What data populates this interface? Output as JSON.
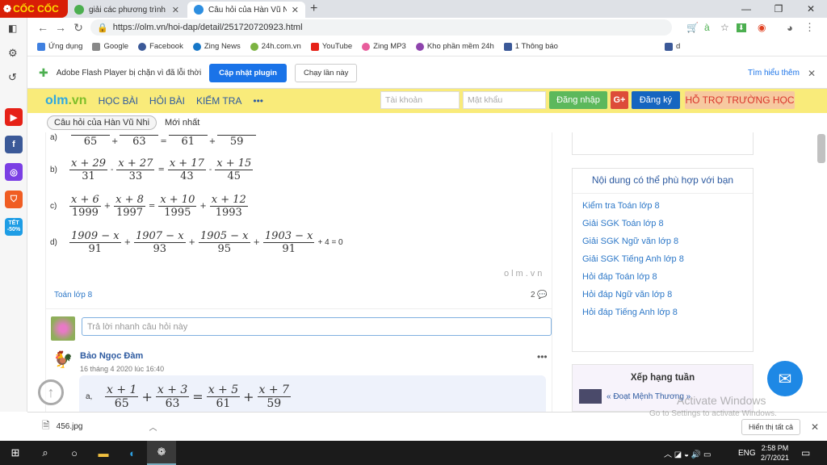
{
  "browser": {
    "logo_text": "CỐC CỐC",
    "tabs": [
      {
        "title": "giải các phương trình sau",
        "active": false
      },
      {
        "title": "Câu hỏi của Hàn Vũ Nhi",
        "active": true
      }
    ],
    "url": "https://olm.vn/hoi-dap/detail/251720720923.html",
    "bookmarks": [
      "Ứng dụng",
      "Google",
      "Facebook",
      "Zing News",
      "24h.com.vn",
      "YouTube",
      "Zing MP3",
      "Kho phần mềm 24h",
      "1 Thông báo",
      "d"
    ]
  },
  "flash": {
    "message": "Adobe Flash Player bị chặn vì đã lỗi thời",
    "update_label": "Cập nhật plugin",
    "run_label": "Chạy lần này",
    "learn_more": "Tìm hiểu thêm"
  },
  "olm": {
    "logo_a": "olm",
    "logo_b": ".vn",
    "nav": [
      "HỌC BÀI",
      "HỎI BÀI",
      "KIỂM TRA",
      "•••"
    ],
    "account_placeholder": "Tài khoản",
    "password_placeholder": "Mật khẩu",
    "login_label": "Đăng nhập",
    "gplus_label": "G+",
    "register_label": "Đăng ký",
    "school_support": "HỖ TRỢ TRƯỜNG HỌC",
    "question_tab": "Câu hỏi của Hàn Vũ Nhi",
    "newest_tab": "Mới nhất"
  },
  "question": {
    "eq_a": {
      "label": "a)",
      "denoms": [
        "65",
        "63",
        "61",
        "59"
      ],
      "ops": [
        "+",
        "=",
        "+"
      ]
    },
    "eq_b": {
      "label": "b)",
      "nums": [
        "x + 29",
        "x + 27",
        "x + 17",
        "x + 15"
      ],
      "denoms": [
        "31",
        "33",
        "43",
        "45"
      ],
      "ops": [
        "-",
        "=",
        "-"
      ]
    },
    "eq_c": {
      "label": "c)",
      "nums": [
        "x + 6",
        "x + 8",
        "x + 10",
        "x + 12"
      ],
      "denoms": [
        "1999",
        "1997",
        "1995",
        "1993"
      ],
      "ops": [
        "+",
        "=",
        "+"
      ]
    },
    "eq_d": {
      "label": "d)",
      "nums": [
        "1909 − x",
        "1907 − x",
        "1905 − x",
        "1903 − x"
      ],
      "denoms": [
        "91",
        "93",
        "95",
        "91"
      ],
      "ops": [
        "+",
        "+",
        "+"
      ],
      "tail": "+ 4 = 0"
    },
    "watermark": "olm.vn",
    "subject": "Toán lớp 8",
    "comment_count": "2",
    "reply_placeholder": "Trả lời nhanh câu hỏi này"
  },
  "answer": {
    "author": "Bảo Ngọc Đàm",
    "date": "16 tháng 4 2020 lúc 16:40",
    "more": "•••",
    "label": "a,",
    "nums": [
      "x + 1",
      "x + 3",
      "x + 5",
      "x + 7"
    ],
    "denoms": [
      "65",
      "63",
      "61",
      "59"
    ],
    "ops": [
      "+",
      "=",
      "+"
    ]
  },
  "sidebar": {
    "heading": "Nội dung có thể phù hợp với bạn",
    "links": [
      "Kiểm tra Toán lớp 8",
      "Giải SGK Toán lớp 8",
      "Giải SGK Ngữ văn lớp 8",
      "Giải SGK Tiếng Anh lớp 8",
      "Hỏi đáp Toán lớp 8",
      "Hỏi đáp Ngữ văn lớp 8",
      "Hỏi đáp Tiếng Anh lớp 8"
    ],
    "ranking_title": "Xếp hạng tuần",
    "ranking_first": "« Đoạt Mệnh Thương »"
  },
  "windows": {
    "activate_title": "Activate Windows",
    "activate_sub": "Go to Settings to activate Windows.",
    "lang": "ENG",
    "time": "2:58 PM",
    "date": "2/7/2021"
  },
  "downloads": {
    "file": "456.jpg",
    "show_all": "Hiển thị tất cả"
  },
  "leftbar": {
    "sale": "TẾT -50%"
  }
}
